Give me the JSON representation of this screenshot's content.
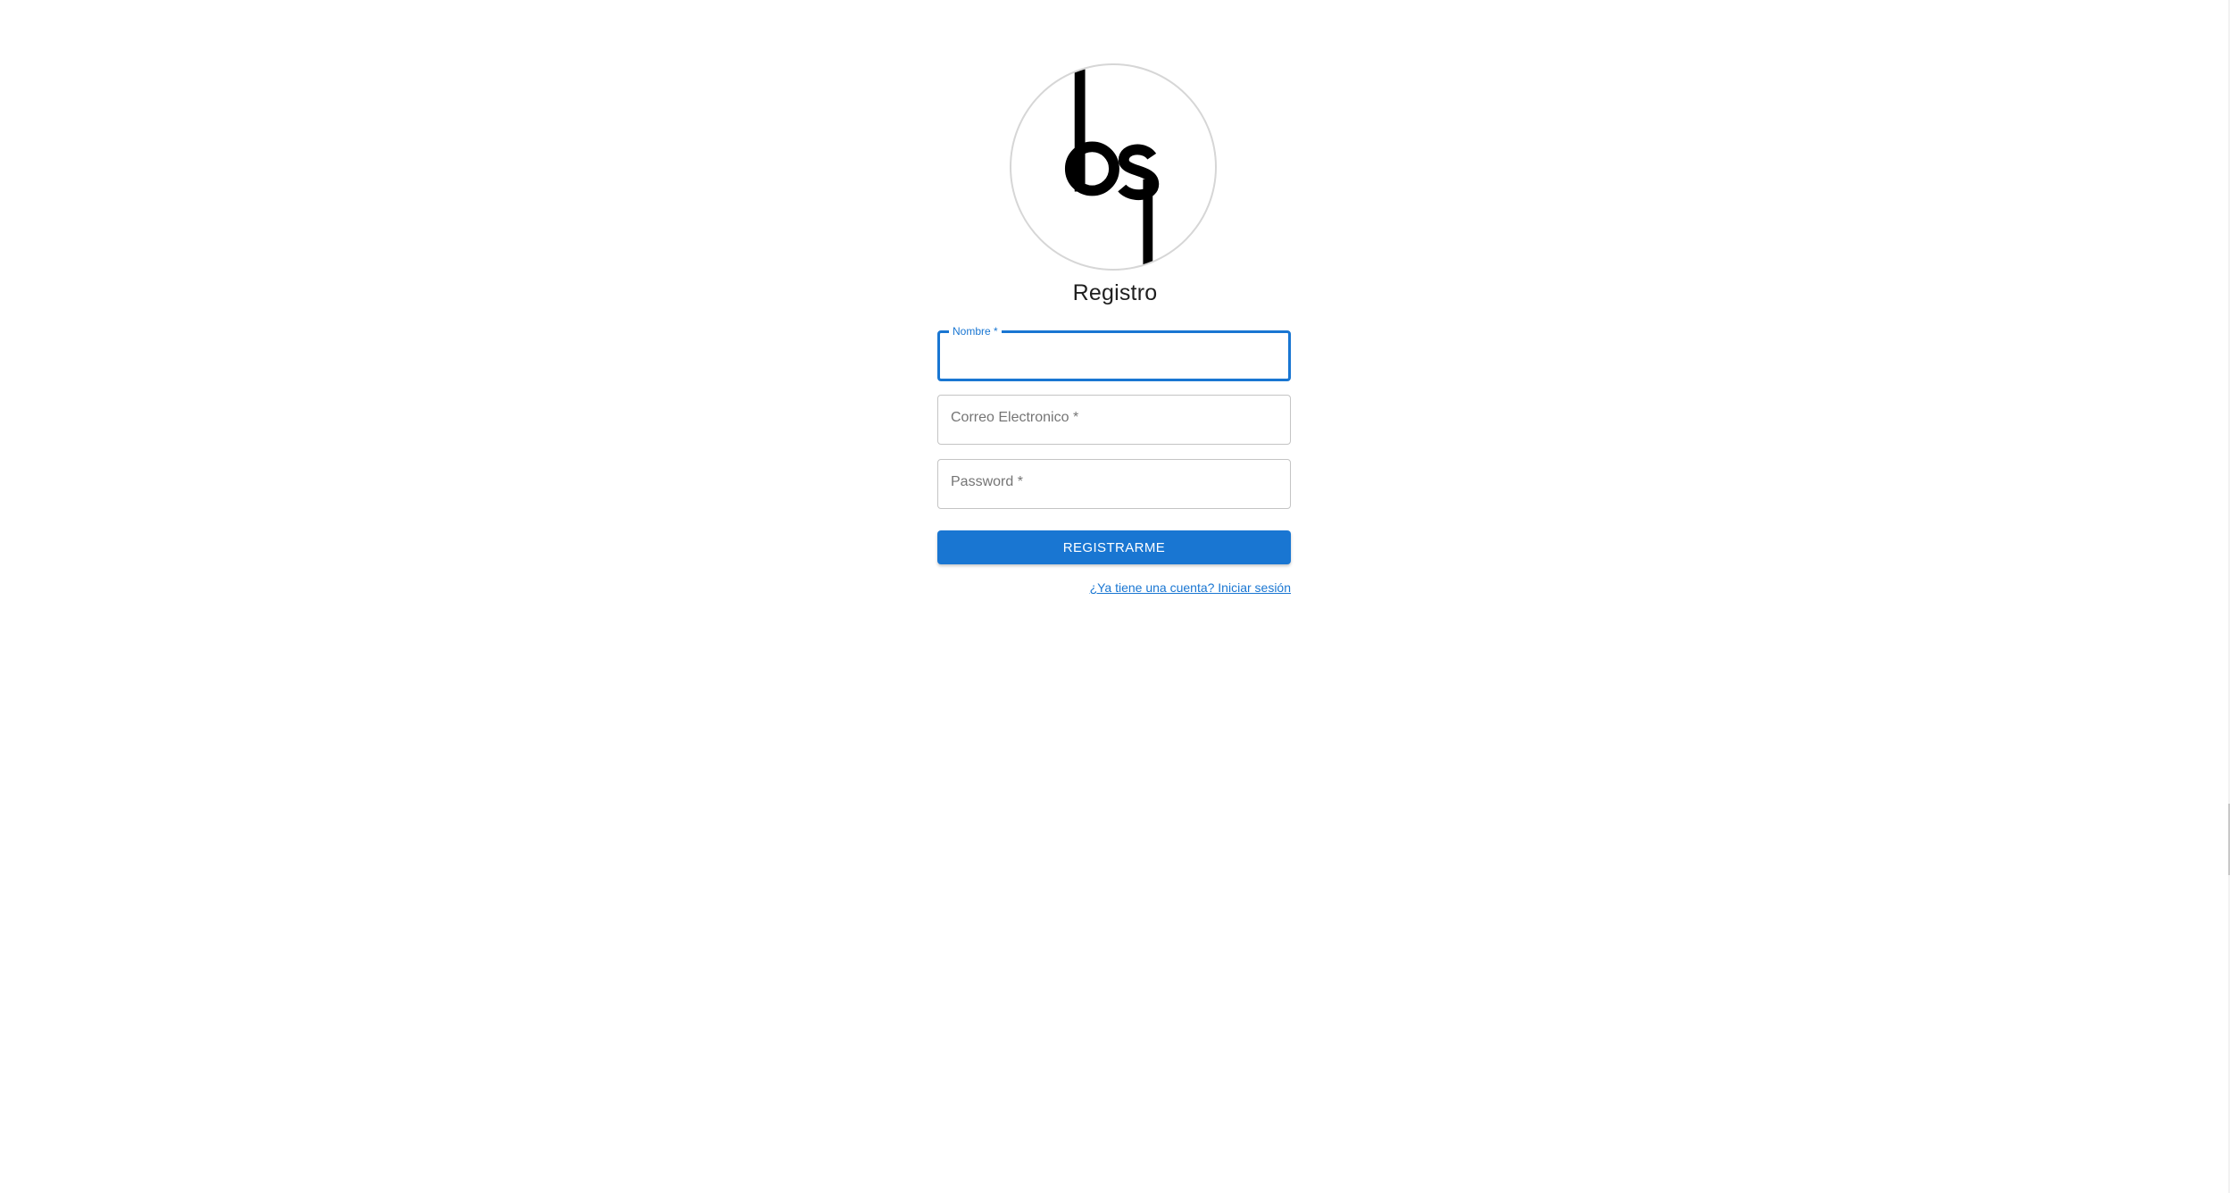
{
  "page": {
    "title": "Registro"
  },
  "logo": {
    "text": "ds",
    "icon": "ds-logo-icon"
  },
  "form": {
    "name_label": "Nombre *",
    "email_label": "Correo Electronico *",
    "password_label": "Password *",
    "submit_label": "REGISTRARME",
    "signin_link": "¿Ya tiene una cuenta? Iniciar sesión"
  },
  "colors": {
    "primary": "#1976d2",
    "border": "#c4c4c4",
    "placeholder": "#757575"
  }
}
